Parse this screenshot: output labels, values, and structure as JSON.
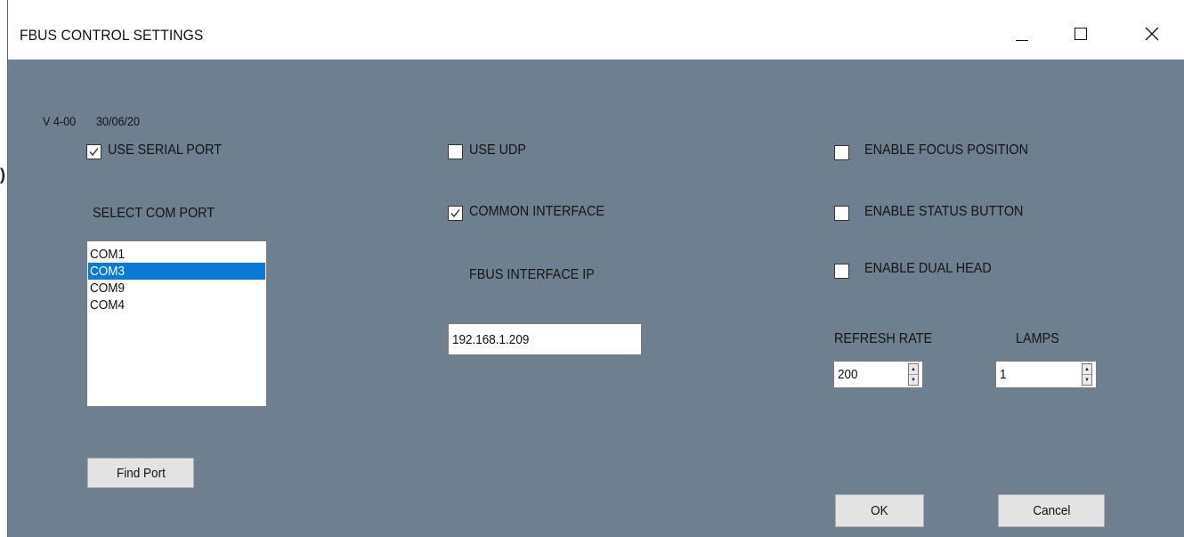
{
  "window": {
    "title": "FBUS CONTROL SETTINGS"
  },
  "version": {
    "number": "V 4-00",
    "date": "30/06/20"
  },
  "serial": {
    "use_serial_label": "USE SERIAL PORT",
    "use_serial_checked": true,
    "select_com_label": "SELECT COM PORT",
    "com_ports": [
      "COM1",
      "COM3",
      "COM9",
      "COM4"
    ],
    "selected_port": "COM3",
    "find_port_label": "Find Port"
  },
  "network": {
    "use_udp_label": "USE UDP",
    "use_udp_checked": false,
    "common_interface_label": "COMMON INTERFACE",
    "common_interface_checked": true,
    "interface_ip_label": "FBUS INTERFACE IP",
    "interface_ip_value": "192.168.1.209"
  },
  "options": {
    "enable_focus_label": "ENABLE FOCUS POSITION",
    "enable_focus_checked": false,
    "enable_status_label": "ENABLE STATUS BUTTON",
    "enable_status_checked": false,
    "enable_dual_label": "ENABLE DUAL HEAD",
    "enable_dual_checked": false,
    "refresh_rate_label": "REFRESH RATE",
    "refresh_rate_value": "200",
    "lamps_label": "LAMPS",
    "lamps_value": "1"
  },
  "actions": {
    "ok_label": "OK",
    "cancel_label": "Cancel"
  },
  "colors": {
    "background": "#6e7f90",
    "selection": "#0a78d7"
  },
  "icons": [
    "minimize-icon",
    "maximize-icon",
    "close-icon",
    "checkmark-icon",
    "spin-up-icon",
    "spin-down-icon"
  ]
}
